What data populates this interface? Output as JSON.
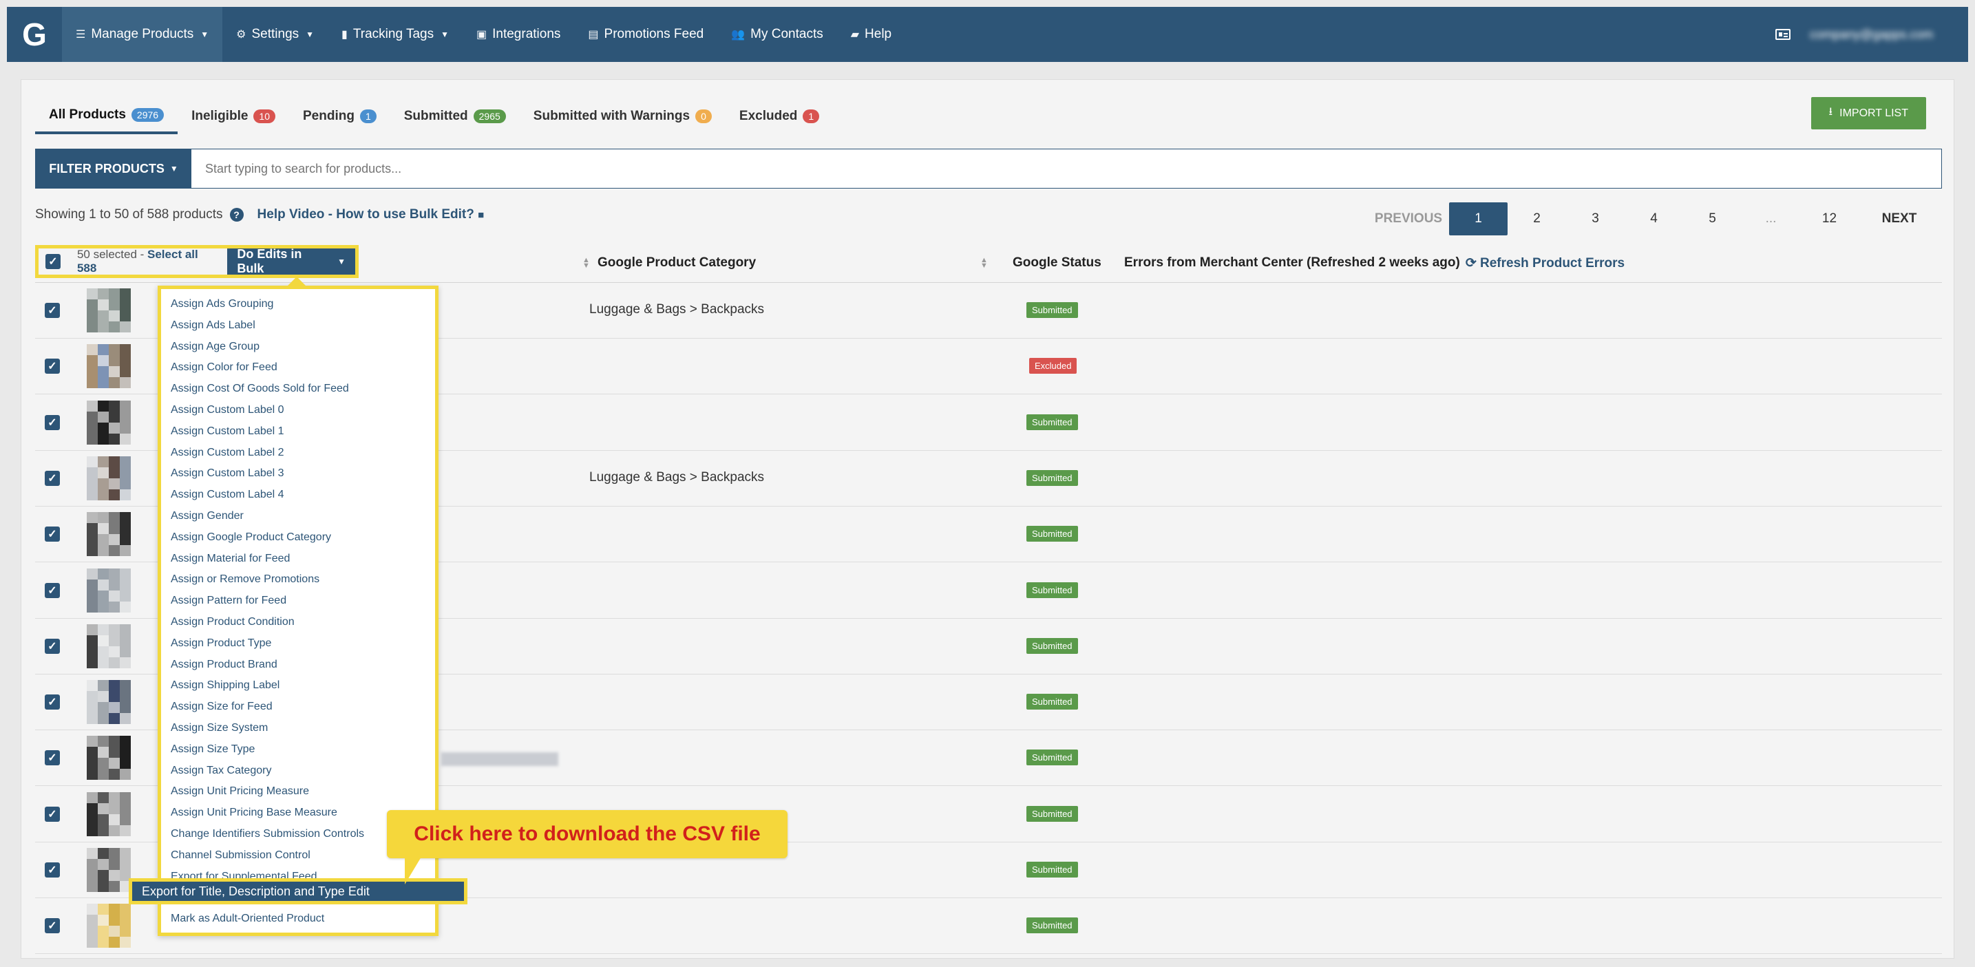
{
  "nav": {
    "logo": "G",
    "items": [
      {
        "label": "Manage Products",
        "icon": "list-icon",
        "caret": true
      },
      {
        "label": "Settings",
        "icon": "gear-icon",
        "caret": true
      },
      {
        "label": "Tracking Tags",
        "icon": "bar-chart-icon",
        "caret": true
      },
      {
        "label": "Integrations",
        "icon": "briefcase-icon",
        "caret": false
      },
      {
        "label": "Promotions Feed",
        "icon": "document-icon",
        "caret": false
      },
      {
        "label": "My Contacts",
        "icon": "users-icon",
        "caret": false
      },
      {
        "label": "Help",
        "icon": "chat-icon",
        "caret": false
      }
    ],
    "account_email": "company@gapps.com"
  },
  "tabs": [
    {
      "label": "All Products",
      "count": "2976",
      "color": "#4a8fcf"
    },
    {
      "label": "Ineligible",
      "count": "10",
      "color": "#d9534f"
    },
    {
      "label": "Pending",
      "count": "1",
      "color": "#4a8fcf"
    },
    {
      "label": "Submitted",
      "count": "2965",
      "color": "#5a9a4a"
    },
    {
      "label": "Submitted with Warnings",
      "count": "0",
      "color": "#f0ad4e"
    },
    {
      "label": "Excluded",
      "count": "1",
      "color": "#d9534f"
    }
  ],
  "import_button": "IMPORT LIST",
  "filter": {
    "button": "FILTER PRODUCTS",
    "placeholder": "Start typing to search for products..."
  },
  "showing": "Showing 1 to 50 of 588 products",
  "help_video": "Help Video - How to use Bulk Edit?",
  "pager": {
    "previous": "PREVIOUS",
    "pages": [
      "1",
      "2",
      "3",
      "4",
      "5",
      "...",
      "12"
    ],
    "next": "NEXT",
    "current": "1"
  },
  "bulk": {
    "selected": "50 selected - ",
    "select_all": "Select all 588",
    "button": "Do Edits in Bulk"
  },
  "columns": {
    "category": "Google Product Category",
    "status": "Google Status",
    "errors": "Errors from Merchant Center (Refreshed 2 weeks ago)",
    "refresh": "Refresh Product Errors"
  },
  "rows": [
    {
      "category": "Luggage & Bags > Backpacks",
      "status": "Submitted"
    },
    {
      "category": "",
      "status": "Excluded"
    },
    {
      "category": "",
      "status": "Submitted"
    },
    {
      "category": "Luggage & Bags > Backpacks",
      "status": "Submitted"
    },
    {
      "category": "",
      "status": "Submitted"
    },
    {
      "category": "",
      "status": "Submitted"
    },
    {
      "category": "",
      "status": "Submitted"
    },
    {
      "category": "",
      "status": "Submitted"
    },
    {
      "category": "",
      "status": "Submitted"
    },
    {
      "category": "",
      "status": "Submitted"
    },
    {
      "category": "",
      "status": "Submitted"
    },
    {
      "category": "",
      "status": "Submitted"
    }
  ],
  "status_colors": {
    "Submitted": "#5a9a4a",
    "Excluded": "#d9534f"
  },
  "bulk_menu": [
    "Assign Ads Grouping",
    "Assign Ads Label",
    "Assign Age Group",
    "Assign Color for Feed",
    "Assign Cost Of Goods Sold for Feed",
    "Assign Custom Label 0",
    "Assign Custom Label 1",
    "Assign Custom Label 2",
    "Assign Custom Label 3",
    "Assign Custom Label 4",
    "Assign Gender",
    "Assign Google Product Category",
    "Assign Material for Feed",
    "Assign or Remove Promotions",
    "Assign Pattern for Feed",
    "Assign Product Condition",
    "Assign Product Type",
    "Assign Product Brand",
    "Assign Shipping Label",
    "Assign Size for Feed",
    "Assign Size System",
    "Assign Size Type",
    "Assign Tax Category",
    "Assign Unit Pricing Measure",
    "Assign Unit Pricing Base Measure",
    "Change Identifiers Submission Controls",
    "Channel Submission Control",
    "Export for Supplemental Feed",
    "",
    "Mark as Adult-Oriented Product"
  ],
  "highlighted_item": "Export for Title, Description and Type Edit",
  "callout": "Click here to download the CSV file"
}
